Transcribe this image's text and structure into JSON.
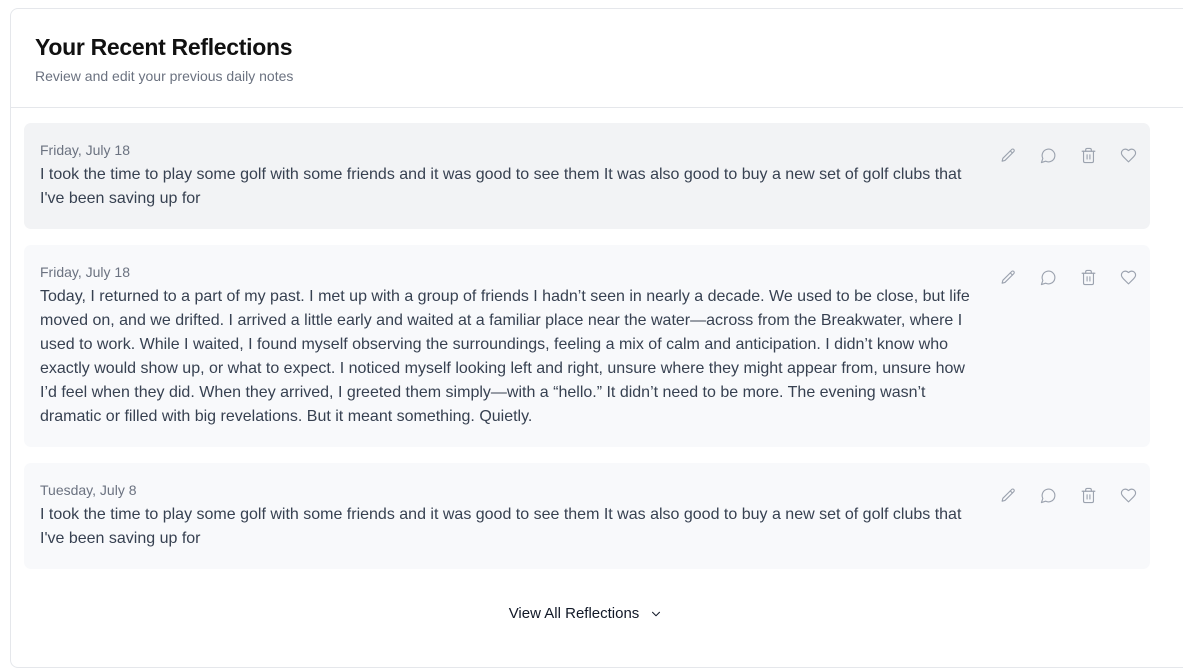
{
  "header": {
    "title": "Your Recent Reflections",
    "subtitle": "Review and edit your previous daily notes"
  },
  "entries": [
    {
      "date": "Friday, July 18",
      "text": "I took the time to play some golf with some friends and it was good to see them It was also good to buy a new set of golf clubs that I've been saving up for"
    },
    {
      "date": "Friday, July 18",
      "text": "Today, I returned to a part of my past. I met up with a group of friends I hadn’t seen in nearly a decade. We used to be close, but life moved on, and we drifted. I arrived a little early and waited at a familiar place near the water—across from the Breakwater, where I used to work. While I waited, I found myself observing the surroundings, feeling a mix of calm and anticipation. I didn’t know who exactly would show up, or what to expect. I noticed myself looking left and right, unsure where they might appear from, unsure how I’d feel when they did. When they arrived, I greeted them simply—with a “hello.” It didn’t need to be more. The evening wasn’t dramatic or filled with big revelations. But it meant something. Quietly."
    },
    {
      "date": "Tuesday, July 8",
      "text": "I took the time to play some golf with some friends and it was good to see them It was also good to buy a new set of golf clubs that I've been saving up for"
    }
  ],
  "actions": {
    "edit_icon": "pencil-icon",
    "comment_icon": "speech-bubble-icon",
    "delete_icon": "trash-icon",
    "favorite_icon": "heart-icon"
  },
  "footer": {
    "view_all_label": "View All Reflections",
    "view_all_icon": "chevron-down-icon"
  },
  "colors": {
    "icon": "#9ca3af",
    "entry_bg": "#f8f9fb",
    "entry_active_bg": "#f2f3f5",
    "border": "#e5e7eb"
  }
}
